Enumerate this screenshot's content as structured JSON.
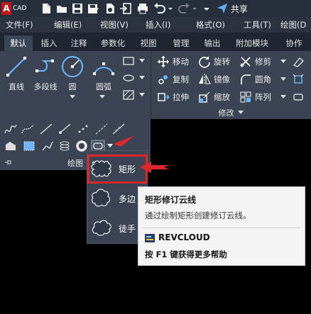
{
  "app": {
    "logo_letter": "A",
    "logo_text": "CAD"
  },
  "titlebar": {
    "share_label": "共享"
  },
  "menu": [
    "文件(F)",
    "编辑(E)",
    "视图(V)",
    "插入(I)",
    "格式(O)",
    "工具(T)",
    "绘图(D"
  ],
  "tabs": [
    "默认",
    "插入",
    "注释",
    "参数化",
    "视图",
    "管理",
    "输出",
    "附加模块",
    "协作"
  ],
  "draw_panel": {
    "tools": [
      "直线",
      "多段线",
      "圆",
      "圆弧"
    ],
    "footer_label": "绘图"
  },
  "modify_panel": {
    "rows": [
      [
        "移动",
        "旋转",
        "修剪"
      ],
      [
        "复制",
        "镜像",
        "圆角"
      ],
      [
        "拉伸",
        "缩放",
        "阵列"
      ]
    ],
    "footer_label": "修改"
  },
  "revcloud_menu": {
    "items": [
      "矩形",
      "多边",
      "徒手"
    ]
  },
  "tooltip": {
    "title": "矩形修订云线",
    "description": "通过绘制矩形创建修订云线。",
    "command": "REVCLOUD",
    "help": "按 F1 键获得更多帮助"
  },
  "colors": {
    "accent_red": "#e0262b",
    "ribbon_bg": "#3b4453",
    "tooltip_bg": "#f4f4f4",
    "logo_red": "#c4161c"
  }
}
